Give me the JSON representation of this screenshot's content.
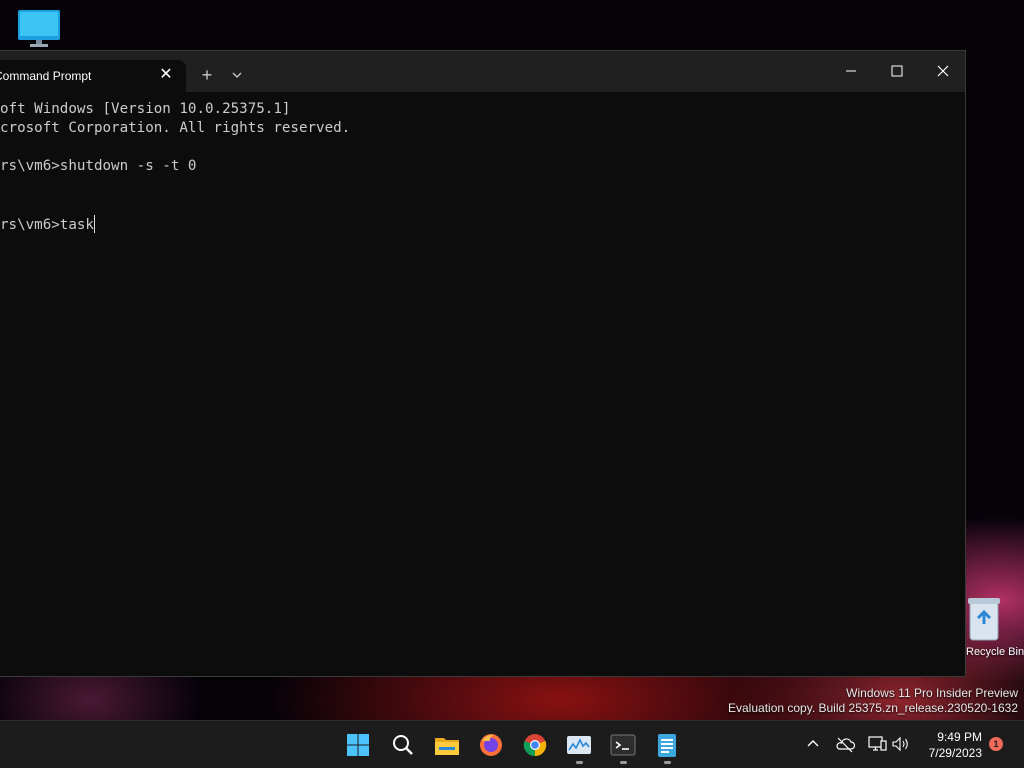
{
  "desktop": {
    "recycle_bin_label": "Recycle Bin",
    "watermark": {
      "line1": "Windows 11 Pro Insider Preview",
      "line2": "Evaluation copy. Build 25375.zn_release.230520-1632"
    }
  },
  "terminal": {
    "tab_title": "Command Prompt",
    "new_tab_symbol": "+",
    "close_symbol": "✕",
    "lines": [
      "oft Windows [Version 10.0.25375.1]",
      "crosoft Corporation. All rights reserved.",
      "",
      "rs\\vm6>shutdown -s -t 0",
      "",
      "",
      "rs\\vm6>task"
    ],
    "colors": {
      "background": "#0c0c0c",
      "titlebar": "#202020",
      "text": "#cccccc"
    }
  },
  "taskbar": {
    "pinned": [
      {
        "icon": "windows-start-icon"
      },
      {
        "icon": "search-icon"
      },
      {
        "icon": "file-explorer-icon"
      },
      {
        "icon": "firefox-icon"
      },
      {
        "icon": "chrome-icon"
      },
      {
        "icon": "task-manager-icon"
      },
      {
        "icon": "terminal-icon"
      },
      {
        "icon": "notepad-icon"
      }
    ],
    "tray_icons": [
      "chevron-up-icon",
      "cloud-offline-icon",
      "network-icon",
      "volume-icon"
    ],
    "clock": {
      "time": "9:49 PM",
      "date": "7/29/2023"
    },
    "notification_count": "1"
  }
}
